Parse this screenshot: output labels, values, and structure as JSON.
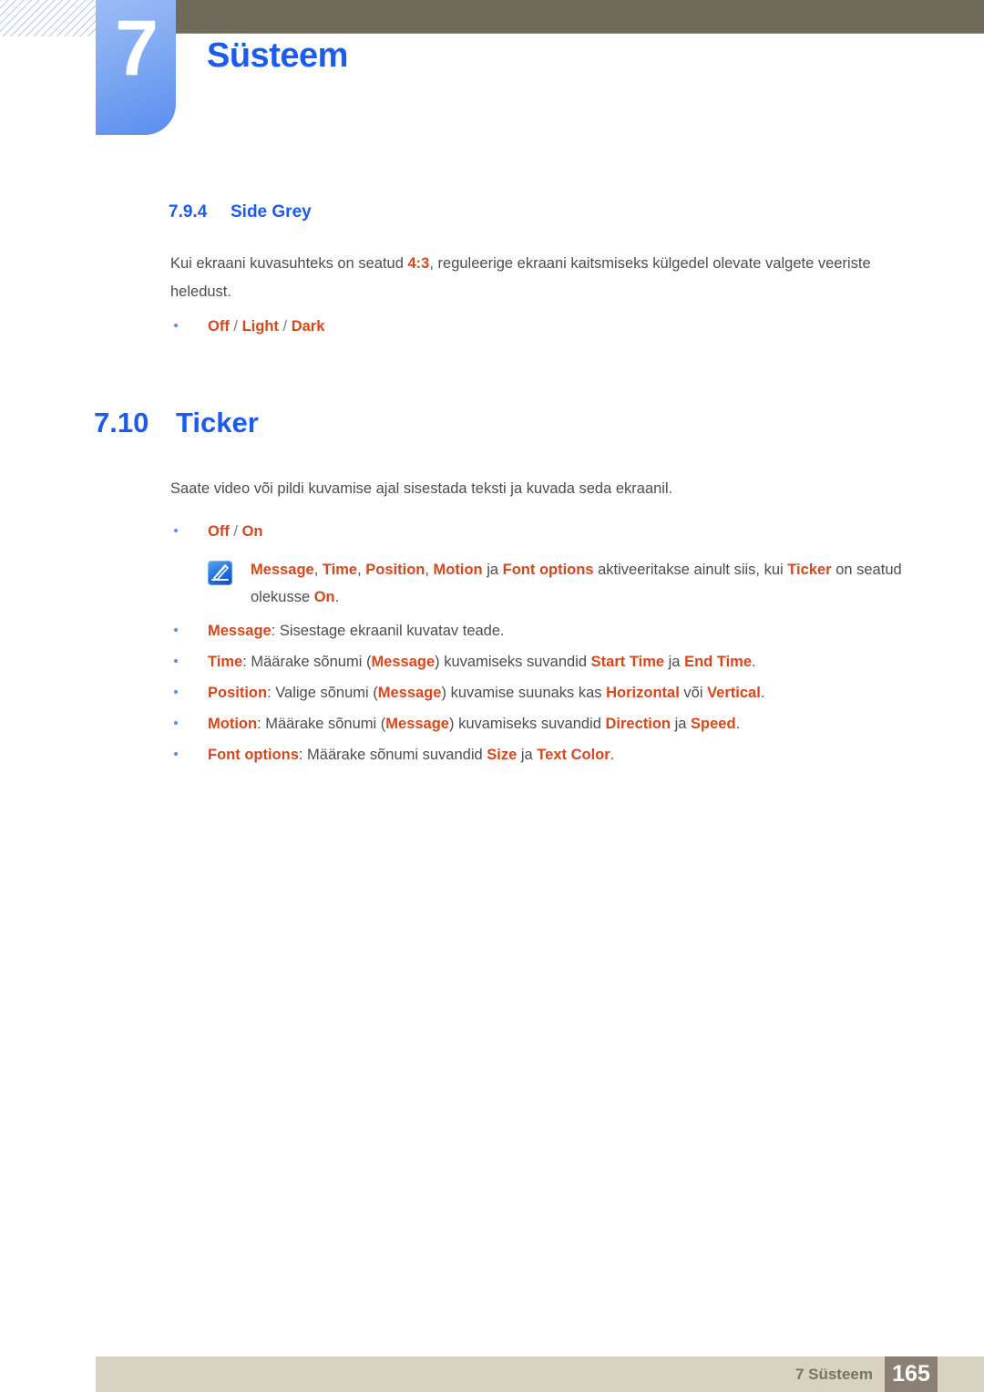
{
  "header": {
    "chapter_number": "7",
    "chapter_title": "Süsteem",
    "accent_blue": "#1a5cf0",
    "olive_bar_color": "#6e6c59"
  },
  "sections": {
    "side_grey": {
      "number": "7.9.4",
      "title": "Side Grey",
      "paragraph_parts": {
        "p1": "Kui ekraani kuvasuhteks on seatud ",
        "kw1": "4:3",
        "p2": ", reguleerige ekraani kaitsmiseks külgedel olevate valgete veeriste heledust."
      },
      "options_bullet": {
        "opt1": "Off",
        "sep1": " / ",
        "opt2": "Light",
        "sep2": " / ",
        "opt3": "Dark"
      }
    },
    "ticker": {
      "number": "7.10",
      "title": "Ticker",
      "paragraph": "Saate video või pildi kuvamise ajal sisestada teksti ja kuvada seda ekraanil.",
      "options_bullet": {
        "opt1": "Off",
        "sep1": " / ",
        "opt2": "On"
      },
      "note": {
        "icon_name": "note-pen-icon",
        "kw1": "Message",
        "t1": ", ",
        "kw2": "Time",
        "t2": ", ",
        "kw3": "Position",
        "t3": ", ",
        "kw4": "Motion",
        "t4": " ja ",
        "kw5": "Font options",
        "t5": " aktiveeritakse ainult siis, kui ",
        "kw6": "Ticker",
        "t6": " on seatud olekusse ",
        "kw7": "On",
        "t7": "."
      },
      "bullets": [
        {
          "kw1": "Message",
          "t1": ": Sisestage ekraanil kuvatav teade."
        },
        {
          "kw1": "Time",
          "t1": ": Määrake sõnumi (",
          "kw2": "Message",
          "t2": ") kuvamiseks suvandid ",
          "kw3": "Start Time",
          "t3": " ja ",
          "kw4": "End Time",
          "t4": "."
        },
        {
          "kw1": "Position",
          "t1": ": Valige sõnumi (",
          "kw2": "Message",
          "t2": ") kuvamise suunaks kas ",
          "kw3": "Horizontal",
          "t3": " või ",
          "kw4": "Vertical",
          "t4": "."
        },
        {
          "kw1": "Motion",
          "t1": ": Määrake sõnumi (",
          "kw2": "Message",
          "t2": ") kuvamiseks suvandid ",
          "kw3": "Direction",
          "t3": " ja ",
          "kw4": "Speed",
          "t4": "."
        },
        {
          "kw1": "Font options",
          "t1": ": Määrake sõnumi suvandid ",
          "kw2": "Size",
          "t2": " ja ",
          "kw3": "Text Color",
          "t3": "."
        }
      ]
    }
  },
  "footer": {
    "label": "7 Süsteem",
    "page_number": "165"
  }
}
